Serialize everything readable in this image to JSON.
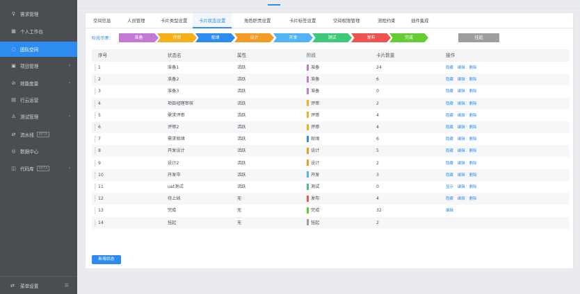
{
  "sidebar": {
    "items": [
      {
        "icon": "bulb-icon",
        "glyph": "♀",
        "label": "需求管理",
        "chevron": false
      },
      {
        "icon": "grid-icon",
        "glyph": "▦",
        "label": "个人工作台",
        "chevron": false
      },
      {
        "icon": "team-icon",
        "glyph": "◌",
        "label": "团队空间",
        "chevron": false
      },
      {
        "icon": "project-icon",
        "glyph": "▣",
        "label": "项目管理",
        "chevron": true
      },
      {
        "icon": "gauge-icon",
        "glyph": "⊘",
        "label": "效能度量",
        "chevron": true
      },
      {
        "icon": "ops-icon",
        "glyph": "▤",
        "label": "行云运营",
        "chevron": false
      },
      {
        "icon": "test-icon",
        "glyph": "♙",
        "label": "测试管理",
        "chevron": true
      },
      {
        "icon": "pipeline-icon",
        "glyph": "⇄",
        "label": "流水线",
        "badge": "BETA",
        "chevron": false
      },
      {
        "icon": "data-icon",
        "glyph": "◎",
        "label": "数据中心",
        "chevron": false
      },
      {
        "icon": "code-icon",
        "glyph": "◫",
        "label": "代码库",
        "badge": "BETA",
        "chevron": true
      }
    ],
    "active_index": 2,
    "bottom": {
      "icon": "menu-settings-icon",
      "label": "菜单设置",
      "collapse_icon": "collapse-icon"
    }
  },
  "tabs": [
    "空间信息",
    "人员管理",
    "卡片类型设置",
    "卡片状态设置",
    "角色职责设置",
    "卡片标签设置",
    "空间权限管理",
    "流程约束",
    "插件集成"
  ],
  "active_tab": 3,
  "stages": {
    "label": "阶段示意：",
    "items": [
      {
        "name": "准备",
        "color": "#c678d6"
      },
      {
        "name": "评审",
        "color": "#f5b01a"
      },
      {
        "name": "就绪",
        "color": "#2d8cf0"
      },
      {
        "name": "设计",
        "color": "#f59a23"
      },
      {
        "name": "开发",
        "color": "#4fb3f6"
      },
      {
        "name": "测试",
        "color": "#3ec97a"
      },
      {
        "name": "发布",
        "color": "#ef5350"
      },
      {
        "name": "完成",
        "color": "#66cc33"
      },
      {
        "name": "挂起",
        "color": "#9e9e9e"
      }
    ]
  },
  "table": {
    "headers": [
      "序号",
      "状态名",
      "属性",
      "阶段",
      "卡片数量",
      "操作"
    ],
    "rows": [
      {
        "no": "1",
        "name": "准备1",
        "attr": "活跃",
        "stage": "准备",
        "color": "#c678d6",
        "count": "24",
        "ops": [
          "隐藏",
          "编辑",
          "删除"
        ]
      },
      {
        "no": "2",
        "name": "准备2",
        "attr": "活跃",
        "stage": "准备",
        "color": "#c678d6",
        "count": "6",
        "ops": [
          "隐藏",
          "编辑",
          "删除"
        ]
      },
      {
        "no": "3",
        "name": "准备3",
        "attr": "活跃",
        "stage": "准备",
        "color": "#c678d6",
        "count": "0",
        "ops": [
          "隐藏",
          "编辑",
          "删除"
        ]
      },
      {
        "no": "4",
        "name": "项目经理审核",
        "attr": "活跃",
        "stage": "评审",
        "color": "#f5b01a",
        "count": "2",
        "ops": [
          "隐藏",
          "编辑",
          "删除"
        ]
      },
      {
        "no": "5",
        "name": "需求评审",
        "attr": "活跃",
        "stage": "评审",
        "color": "#f5b01a",
        "count": "4",
        "ops": [
          "隐藏",
          "编辑",
          "删除"
        ]
      },
      {
        "no": "6",
        "name": "评审2",
        "attr": "活跃",
        "stage": "评审",
        "color": "#f5b01a",
        "count": "4",
        "ops": [
          "隐藏",
          "编辑",
          "删除"
        ]
      },
      {
        "no": "7",
        "name": "需求就绪",
        "attr": "活跃",
        "stage": "就绪",
        "color": "#2d8cf0",
        "count": "6",
        "ops": [
          "隐藏",
          "编辑",
          "删除"
        ]
      },
      {
        "no": "8",
        "name": "开发设计",
        "attr": "活跃",
        "stage": "设计",
        "color": "#f59a23",
        "count": "5",
        "ops": [
          "隐藏",
          "编辑",
          "删除"
        ]
      },
      {
        "no": "9",
        "name": "设计2",
        "attr": "活跃",
        "stage": "设计",
        "color": "#f59a23",
        "count": "2",
        "ops": [
          "隐藏",
          "编辑",
          "删除"
        ]
      },
      {
        "no": "10",
        "name": "开发中",
        "attr": "活跃",
        "stage": "开发",
        "color": "#4fb3f6",
        "count": "3",
        "ops": [
          "隐藏",
          "编辑",
          "删除"
        ]
      },
      {
        "no": "11",
        "name": "uat测试",
        "attr": "活跃",
        "stage": "测试",
        "color": "#3ec97a",
        "count": "0",
        "ops": [
          "显示",
          "编辑",
          "删除"
        ]
      },
      {
        "no": "12",
        "name": "待上线",
        "attr": "无",
        "stage": "发布",
        "color": "#ef5350",
        "count": "4",
        "ops": [
          "隐藏",
          "编辑",
          "删除"
        ]
      },
      {
        "no": "13",
        "name": "完成",
        "attr": "无",
        "stage": "完成",
        "color": "#66cc33",
        "count": "32",
        "ops": [
          "编辑"
        ]
      },
      {
        "no": "14",
        "name": "挂起",
        "attr": "无",
        "stage": "挂起",
        "color": "#9e9e9e",
        "count": "2",
        "ops": []
      }
    ]
  },
  "add_button": "新增状态"
}
